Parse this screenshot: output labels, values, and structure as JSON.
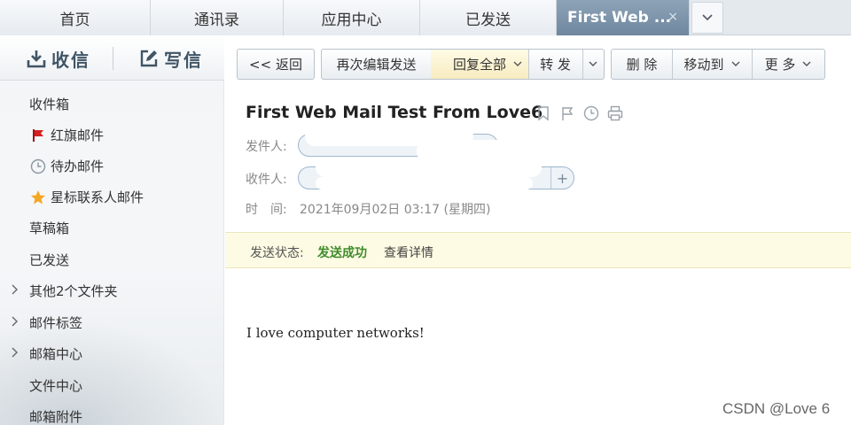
{
  "tabs": [
    {
      "label": "首页"
    },
    {
      "label": "通讯录"
    },
    {
      "label": "应用中心"
    },
    {
      "label": "已发送"
    },
    {
      "label": "First Web ..."
    }
  ],
  "tab_close_glyph": "×",
  "sidebar": {
    "receive_label": "收信",
    "write_label": "写信",
    "items": [
      {
        "label": "收件箱"
      },
      {
        "label": "红旗邮件",
        "icon": "red-flag-icon"
      },
      {
        "label": "待办邮件",
        "icon": "clock-icon"
      },
      {
        "label": "星标联系人邮件",
        "icon": "star-icon"
      },
      {
        "label": "草稿箱"
      },
      {
        "label": "已发送"
      },
      {
        "label": "其他2个文件夹",
        "expandable": true
      },
      {
        "label": "邮件标签",
        "expandable": true
      },
      {
        "label": "邮箱中心",
        "expandable": true
      },
      {
        "label": "文件中心"
      },
      {
        "label": "邮箱附件"
      }
    ]
  },
  "toolbar": {
    "back": "<< 返回",
    "reedit": "再次编辑发送",
    "reply_all": "回复全部",
    "forward": "转 发",
    "delete": "删 除",
    "move_to": "移动到",
    "more": "更 多"
  },
  "mail": {
    "subject": "First Web Mail Test From Love6",
    "from_label": "发件人:",
    "to_label": "收件人:",
    "time_label": "时　间:",
    "time_value": "2021年09月02日 03:17 (星期四)",
    "status_label": "发送状态:",
    "status_value": "发送成功",
    "status_detail_link": "查看详情",
    "body": "I love computer networks!"
  },
  "watermark": "CSDN @Love 6",
  "colors": {
    "active_tab": "#7a91a8",
    "status_success": "#3f8b2c",
    "highlight_button": "#fdf3c8",
    "red_flag": "#d42020",
    "star": "#f5a623"
  }
}
